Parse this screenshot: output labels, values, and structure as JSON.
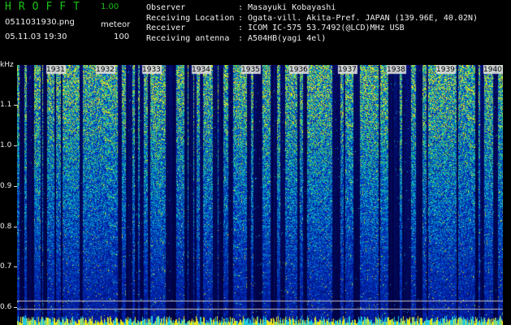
{
  "header": {
    "title": "HROFFT",
    "version": "1.00",
    "filename": "0511031930.png",
    "mode": "meteor",
    "datetime": "05.11.03 19:30",
    "count": "100"
  },
  "station": {
    "observer_label": "Observer",
    "observer": ": Masayuki Kobayashi",
    "location_label": "Receiving Location",
    "location": ": Ogata-vill. Akita-Pref. JAPAN (139.96E, 40.02N)",
    "receiver_label": "Receiver",
    "receiver": ": ICOM IC-575 53.7492(@LCD)MHz USB",
    "antenna_label": "Receiving antenna",
    "antenna": ": A504HB(yagi 4el)"
  },
  "axis": {
    "y_unit": "kHz",
    "y_ticks": [
      "1.1",
      "1.0",
      "0.9",
      "0.8",
      "0.7",
      "0.6"
    ],
    "x_ticks": [
      "1931",
      "1932",
      "1933",
      "1934",
      "1935",
      "1936",
      "1937",
      "1938",
      "1939",
      "1940"
    ]
  },
  "colors": {
    "background": "#000000",
    "title": "#18c418",
    "text": "#f0f0f0",
    "signal_low": "#0a1a8c",
    "signal_high": "#e6e61e"
  }
}
